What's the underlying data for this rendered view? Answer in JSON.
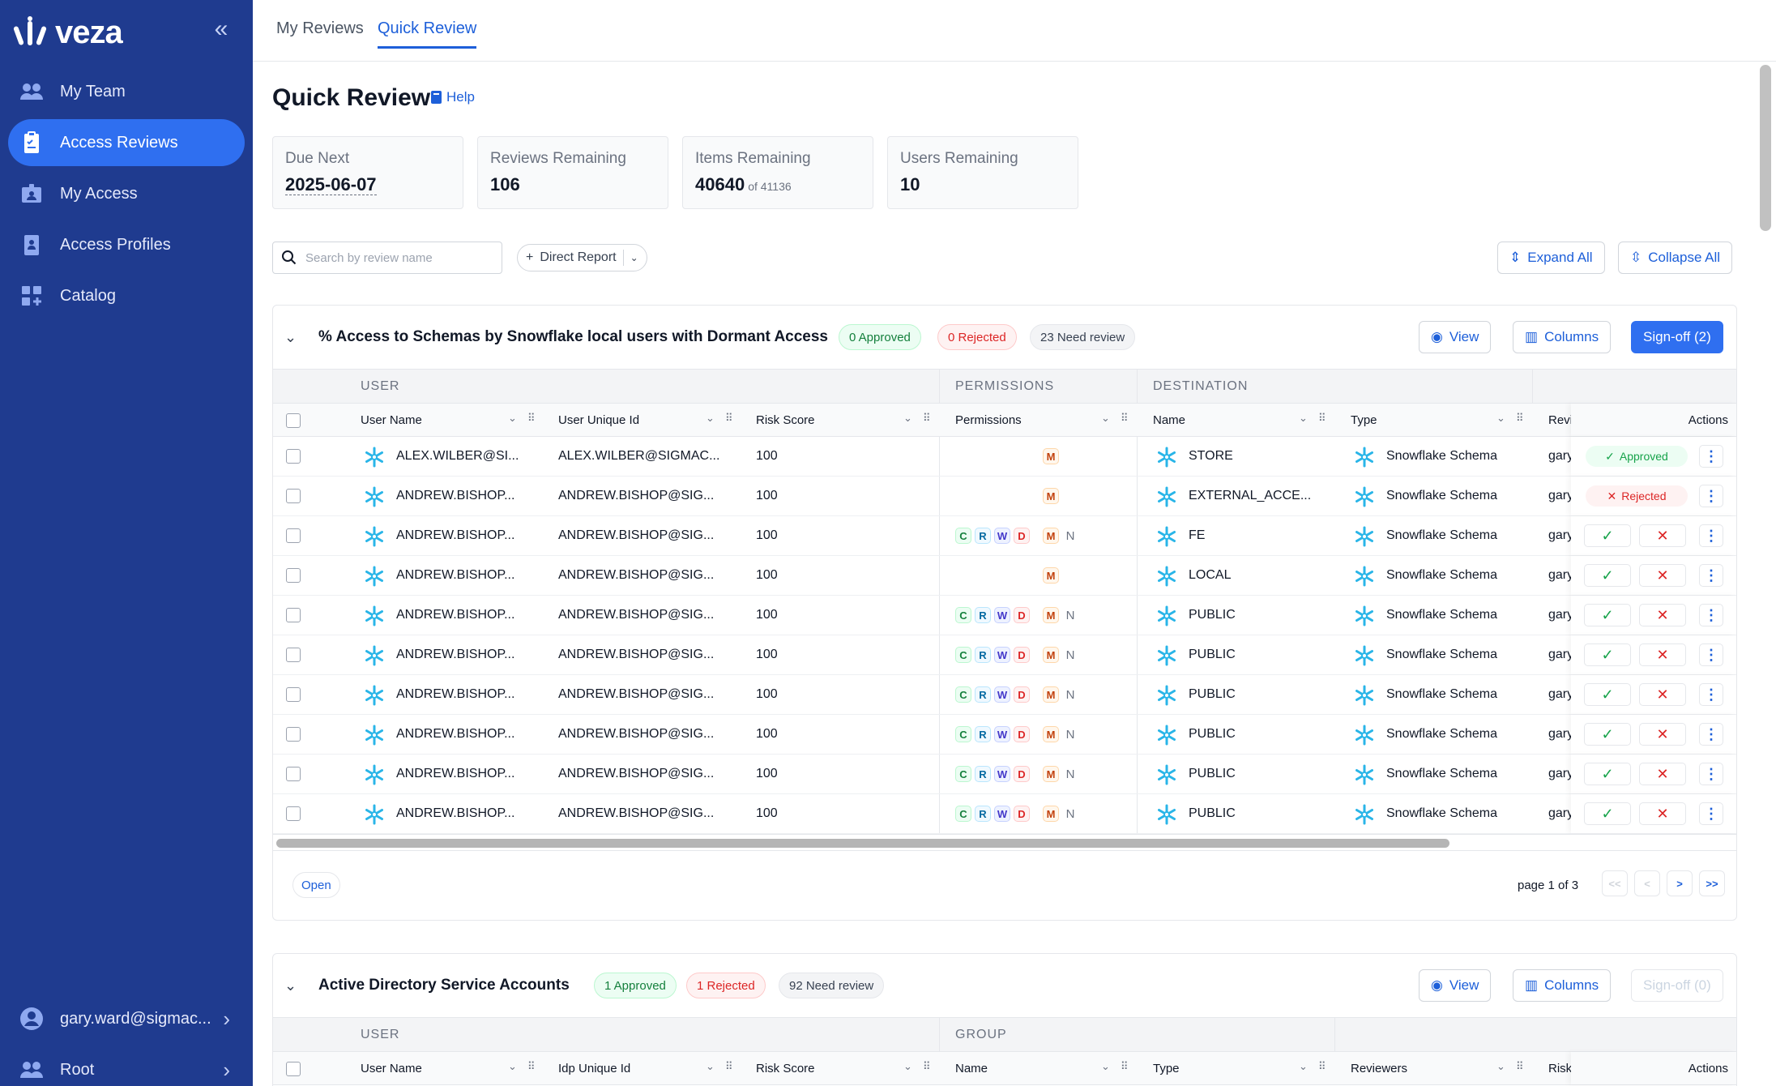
{
  "app": {
    "logo": "veza"
  },
  "sidebar": {
    "items": [
      {
        "label": "My Team",
        "icon": "team-icon"
      },
      {
        "label": "Access Reviews",
        "icon": "clipboard-icon"
      },
      {
        "label": "My Access",
        "icon": "id-badge-icon"
      },
      {
        "label": "Access Profiles",
        "icon": "profile-card-icon"
      },
      {
        "label": "Catalog",
        "icon": "grid-plus-icon"
      }
    ],
    "active": "Access Reviews",
    "user": "gary.ward@sigmac...",
    "org": "Root"
  },
  "tabs": [
    "My Reviews",
    "Quick Review"
  ],
  "active_tab": "Quick Review",
  "page": {
    "title": "Quick Review",
    "help": "Help"
  },
  "stats": [
    {
      "label": "Due Next",
      "value": "2025-06-07",
      "sub": ""
    },
    {
      "label": "Reviews Remaining",
      "value": "106",
      "sub": ""
    },
    {
      "label": "Items Remaining",
      "value": "40640",
      "sub": "of 41136"
    },
    {
      "label": "Users Remaining",
      "value": "10",
      "sub": ""
    }
  ],
  "toolbar": {
    "search_placeholder": "Search by review name",
    "filter": "Direct Report",
    "expand_all": "Expand All",
    "collapse_all": "Collapse All"
  },
  "card1": {
    "title": "% Access to Schemas by Snowflake local users with Dormant Access",
    "approved": "0 Approved",
    "rejected": "0 Rejected",
    "need_review": "23 Need review",
    "view": "View",
    "columns": "Columns",
    "signoff": "Sign-off (2)",
    "groups": {
      "user": "USER",
      "permissions": "PERMISSIONS",
      "destination": "DESTINATION"
    },
    "headers": {
      "user_name": "User Name",
      "user_unique_id": "User Unique Id",
      "risk_score": "Risk Score",
      "permissions": "Permissions",
      "name": "Name",
      "type": "Type",
      "reviewer": "Revi",
      "actions": "Actions"
    },
    "rows": [
      {
        "user": "ALEX.WILBER@SI...",
        "uid": "ALEX.WILBER@SIGMAC...",
        "risk": "100",
        "perms": [
          "M"
        ],
        "name": "STORE",
        "type": "Snowflake Schema",
        "reviewer": "gary",
        "status": "Approved"
      },
      {
        "user": "ANDREW.BISHOP...",
        "uid": "ANDREW.BISHOP@SIG...",
        "risk": "100",
        "perms": [
          "M"
        ],
        "name": "EXTERNAL_ACCE...",
        "type": "Snowflake Schema",
        "reviewer": "gary",
        "status": "Rejected"
      },
      {
        "user": "ANDREW.BISHOP...",
        "uid": "ANDREW.BISHOP@SIG...",
        "risk": "100",
        "perms": [
          "C",
          "R",
          "W",
          "D",
          "M",
          "N"
        ],
        "name": "FE",
        "type": "Snowflake Schema",
        "reviewer": "gary",
        "status": ""
      },
      {
        "user": "ANDREW.BISHOP...",
        "uid": "ANDREW.BISHOP@SIG...",
        "risk": "100",
        "perms": [
          "M"
        ],
        "name": "LOCAL",
        "type": "Snowflake Schema",
        "reviewer": "gary",
        "status": ""
      },
      {
        "user": "ANDREW.BISHOP...",
        "uid": "ANDREW.BISHOP@SIG...",
        "risk": "100",
        "perms": [
          "C",
          "R",
          "W",
          "D",
          "M",
          "N"
        ],
        "name": "PUBLIC",
        "type": "Snowflake Schema",
        "reviewer": "gary",
        "status": ""
      },
      {
        "user": "ANDREW.BISHOP...",
        "uid": "ANDREW.BISHOP@SIG...",
        "risk": "100",
        "perms": [
          "C",
          "R",
          "W",
          "D",
          "M",
          "N"
        ],
        "name": "PUBLIC",
        "type": "Snowflake Schema",
        "reviewer": "gary",
        "status": ""
      },
      {
        "user": "ANDREW.BISHOP...",
        "uid": "ANDREW.BISHOP@SIG...",
        "risk": "100",
        "perms": [
          "C",
          "R",
          "W",
          "D",
          "M",
          "N"
        ],
        "name": "PUBLIC",
        "type": "Snowflake Schema",
        "reviewer": "gary",
        "status": ""
      },
      {
        "user": "ANDREW.BISHOP...",
        "uid": "ANDREW.BISHOP@SIG...",
        "risk": "100",
        "perms": [
          "C",
          "R",
          "W",
          "D",
          "M",
          "N"
        ],
        "name": "PUBLIC",
        "type": "Snowflake Schema",
        "reviewer": "gary",
        "status": ""
      },
      {
        "user": "ANDREW.BISHOP...",
        "uid": "ANDREW.BISHOP@SIG...",
        "risk": "100",
        "perms": [
          "C",
          "R",
          "W",
          "D",
          "M",
          "N"
        ],
        "name": "PUBLIC",
        "type": "Snowflake Schema",
        "reviewer": "gary",
        "status": ""
      },
      {
        "user": "ANDREW.BISHOP...",
        "uid": "ANDREW.BISHOP@SIG...",
        "risk": "100",
        "perms": [
          "C",
          "R",
          "W",
          "D",
          "M",
          "N"
        ],
        "name": "PUBLIC",
        "type": "Snowflake Schema",
        "reviewer": "gary",
        "status": ""
      }
    ],
    "open": "Open",
    "page_label": "page 1 of 3",
    "pager": {
      "first": "<<",
      "prev": "<",
      "next": ">",
      "last": ">>"
    }
  },
  "card2": {
    "title": "Active Directory Service Accounts",
    "approved": "1 Approved",
    "rejected": "1 Rejected",
    "need_review": "92 Need review",
    "view": "View",
    "columns": "Columns",
    "signoff": "Sign-off (0)",
    "groups": {
      "user": "USER",
      "group": "GROUP"
    },
    "headers": {
      "user_name": "User Name",
      "idp_unique_id": "Idp Unique Id",
      "risk_score": "Risk Score",
      "name": "Name",
      "type": "Type",
      "reviewers": "Reviewers",
      "risk": "Risk",
      "actions": "Actions"
    }
  },
  "colors": {
    "sidebar": "#1f3b8f",
    "accent": "#2f6ff0",
    "link": "#1d5fd9",
    "snowflake": "#29b5e8"
  }
}
